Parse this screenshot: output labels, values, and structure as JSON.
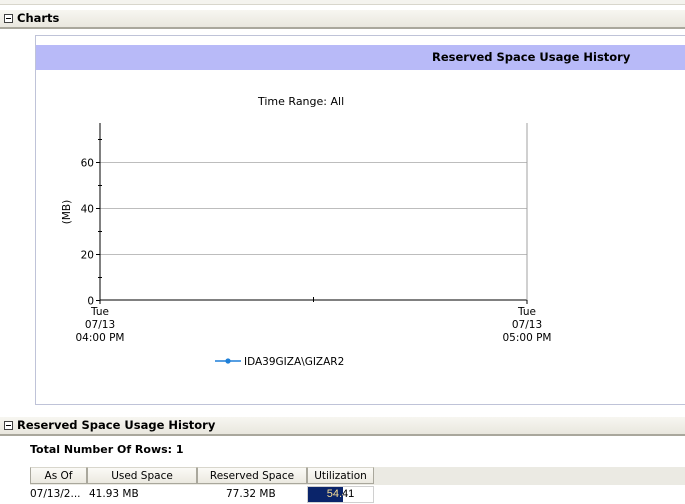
{
  "charts_section": {
    "title": "Charts"
  },
  "chart": {
    "title": "Reserved Space Usage History",
    "time_range": "Time Range: All",
    "ylabel": "(MB)",
    "legend_label": "IDA39GIZA\\GIZAR2"
  },
  "chart_data": {
    "type": "line",
    "title": "Reserved Space Usage History",
    "subtitle": "Time Range: All",
    "xlabel": "",
    "ylabel": "(MB)",
    "ylim": [
      0,
      77
    ],
    "y_ticks": [
      0,
      20,
      40,
      60
    ],
    "x_ticks": [
      {
        "day": "Tue",
        "date": "07/13",
        "time": "04:00 PM"
      },
      {
        "day": "Tue",
        "date": "07/13",
        "time": "05:00 PM"
      }
    ],
    "grid": true,
    "legend_position": "bottom",
    "series": [
      {
        "name": "IDA39GIZA\\GIZAR2",
        "color": "#1e7fd8",
        "values": []
      }
    ]
  },
  "history_section": {
    "title": "Reserved Space Usage History"
  },
  "table": {
    "total_rows_label": "Total Number Of Rows: 1",
    "columns": [
      "As Of",
      "Used Space",
      "Reserved Space",
      "Utilization"
    ],
    "rows": [
      {
        "as_of": "07/13/2...",
        "used_space": "41.93 MB",
        "reserved_space": "77.32 MB",
        "utilization": "54.41",
        "utilization_fraction": 0.5441
      }
    ]
  },
  "colors": {
    "chart_titlebar": "#b8baf8",
    "utilization_bar": "#0a246a",
    "series_line": "#1e7fd8"
  }
}
